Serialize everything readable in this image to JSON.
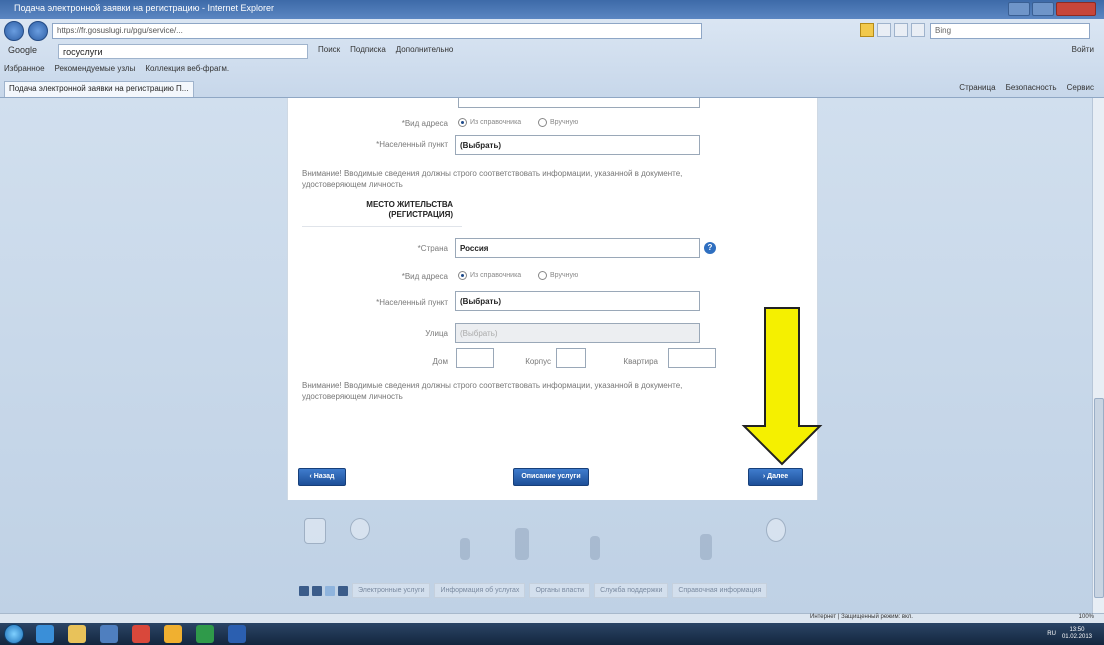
{
  "window": {
    "title": "Подача электронной заявки на регистрацию - Internet Explorer"
  },
  "browser": {
    "address": "https://fr.gosuslugi.ru/pgu/service/...",
    "bing_placeholder": "Bing",
    "search_engine_label": "Google",
    "search_query": "госуслуги",
    "search_tools": [
      "Поиск",
      "Подписка",
      "Дополнительно"
    ],
    "login_label": "Войти",
    "favorites": [
      "Избранное",
      "Рекомендуемые узлы",
      "Коллекция веб-фрагм."
    ],
    "active_tab": "Подача электронной заявки на регистрацию П...",
    "command_bar": [
      "Страница",
      "Безопасность",
      "Сервис"
    ]
  },
  "form": {
    "top_group": {
      "address_type_label": "*Вид адреса",
      "radio_from_list": "Из справочника",
      "radio_manual": "Вручную",
      "locality_label": "*Населенный пункт",
      "locality_value": "(Выбрать)",
      "warning": "Внимание! Вводимые сведения должны строго соответствовать информации, указанной в документе, удостоверяющем личность"
    },
    "residence_section": {
      "title": "МЕСТО ЖИТЕЛЬСТВА (РЕГИСТРАЦИЯ)",
      "country_label": "*Страна",
      "country_value": "Россия",
      "info_icon_glyph": "?",
      "address_type_label": "*Вид адреса",
      "radio_from_list": "Из справочника",
      "radio_manual": "Вручную",
      "locality_label": "*Населенный пункт",
      "locality_value": "(Выбрать)",
      "street_label": "Улица",
      "street_value": "(Выбрать)",
      "house_label": "Дом",
      "building_label": "Корпус",
      "apartment_label": "Квартира",
      "warning": "Внимание! Вводимые сведения должны строго соответствовать информации, указанной в документе, удостоверяющем личность"
    },
    "buttons": {
      "back": "‹ Назад",
      "service_description": "Описание услуги",
      "next": "› Далее"
    }
  },
  "footer": {
    "links": [
      "Электронные услуги",
      "Информация об услугах",
      "Органы власти",
      "Служба поддержки",
      "Справочная информация"
    ]
  },
  "statusbar": {
    "zone": "Интернет | Защищенный режим: вкл.",
    "zoom": "100%"
  },
  "taskbar": {
    "time": "13:50",
    "date": "01.02.2013",
    "lang": "RU"
  },
  "colors": {
    "accent": "#1d4f98",
    "arrow": "#f5f000",
    "page_bg": "#c9d7e6"
  }
}
